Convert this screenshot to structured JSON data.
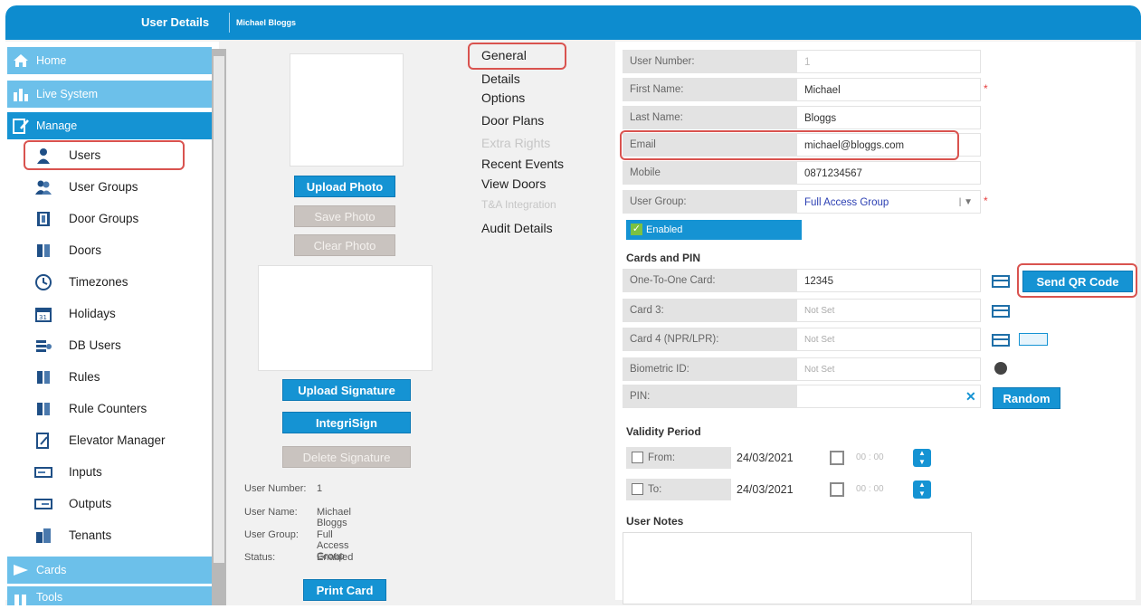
{
  "header": {
    "title": "User Details",
    "user_name": "Michael Bloggs"
  },
  "sidebar": {
    "sections": [
      {
        "label": "Home",
        "icon": "home-icon"
      },
      {
        "label": "Live System",
        "icon": "live-system-icon"
      },
      {
        "label": "Manage",
        "icon": "manage-icon"
      },
      {
        "label": "Cards",
        "icon": "cards-icon"
      },
      {
        "label": "Tools",
        "icon": "tools-icon"
      }
    ],
    "items": [
      {
        "label": "Users",
        "icon": "user-icon"
      },
      {
        "label": "User Groups",
        "icon": "user-groups-icon"
      },
      {
        "label": "Door Groups",
        "icon": "door-groups-icon"
      },
      {
        "label": "Doors",
        "icon": "door-icon"
      },
      {
        "label": "Timezones",
        "icon": "clock-icon"
      },
      {
        "label": "Holidays",
        "icon": "calendar-icon"
      },
      {
        "label": "DB Users",
        "icon": "db-users-icon"
      },
      {
        "label": "Rules",
        "icon": "rules-icon"
      },
      {
        "label": "Rule Counters",
        "icon": "rule-counters-icon"
      },
      {
        "label": "Elevator Manager",
        "icon": "elevator-icon"
      },
      {
        "label": "Inputs",
        "icon": "inputs-icon"
      },
      {
        "label": "Outputs",
        "icon": "outputs-icon"
      },
      {
        "label": "Tenants",
        "icon": "tenants-icon"
      }
    ]
  },
  "photo": {
    "upload_photo": "Upload Photo",
    "save_photo": "Save Photo",
    "clear_photo": "Clear Photo",
    "upload_signature": "Upload Signature",
    "integrisign": "IntegriSign",
    "delete_signature": "Delete Signature",
    "print_card": "Print Card"
  },
  "summary": {
    "user_number_label": "User Number:",
    "user_number": "1",
    "user_name_label": "User Name:",
    "user_name": "Michael Bloggs",
    "user_group_label": "User Group:",
    "user_group": "Full Access Group",
    "status_label": "Status:",
    "status": "Enabled"
  },
  "tabs": [
    {
      "label": "General",
      "enabled": true
    },
    {
      "label": "Details",
      "enabled": true
    },
    {
      "label": "Options",
      "enabled": true
    },
    {
      "label": "Door Plans",
      "enabled": true
    },
    {
      "label": "Extra Rights",
      "enabled": false
    },
    {
      "label": "Recent Events",
      "enabled": true
    },
    {
      "label": "View Doors",
      "enabled": true
    },
    {
      "label": "T&A Integration",
      "enabled": false
    },
    {
      "label": "Audit Details",
      "enabled": true
    }
  ],
  "general": {
    "user_number": {
      "label": "User Number:",
      "value": "1"
    },
    "first_name": {
      "label": "First Name:",
      "value": "Michael"
    },
    "last_name": {
      "label": "Last Name:",
      "value": "Bloggs"
    },
    "email": {
      "label": "Email",
      "value": "michael@bloggs.com"
    },
    "mobile": {
      "label": "Mobile",
      "value": "0871234567"
    },
    "user_group": {
      "label": "User Group:",
      "value": "Full Access Group"
    },
    "enabled_label": "Enabled",
    "required_mark": "*"
  },
  "cards": {
    "heading": "Cards and PIN",
    "one_to_one": {
      "label": "One-To-One Card:",
      "value": "12345"
    },
    "card3": {
      "label": "Card 3:",
      "value": "Not Set"
    },
    "card4": {
      "label": "Card 4 (NPR/LPR):",
      "value": "Not Set"
    },
    "biometric": {
      "label": "Biometric ID:",
      "value": "Not Set"
    },
    "pin": {
      "label": "PIN:",
      "value": ""
    },
    "send_qr": "Send QR Code",
    "random": "Random",
    "clear_glyph": "✕"
  },
  "validity": {
    "heading": "Validity Period",
    "from": {
      "label": "From:",
      "date": "24/03/2021",
      "time": "00 : 00"
    },
    "to": {
      "label": "To:",
      "date": "24/03/2021",
      "time": "00 : 00"
    }
  },
  "notes": {
    "heading": "User Notes"
  }
}
